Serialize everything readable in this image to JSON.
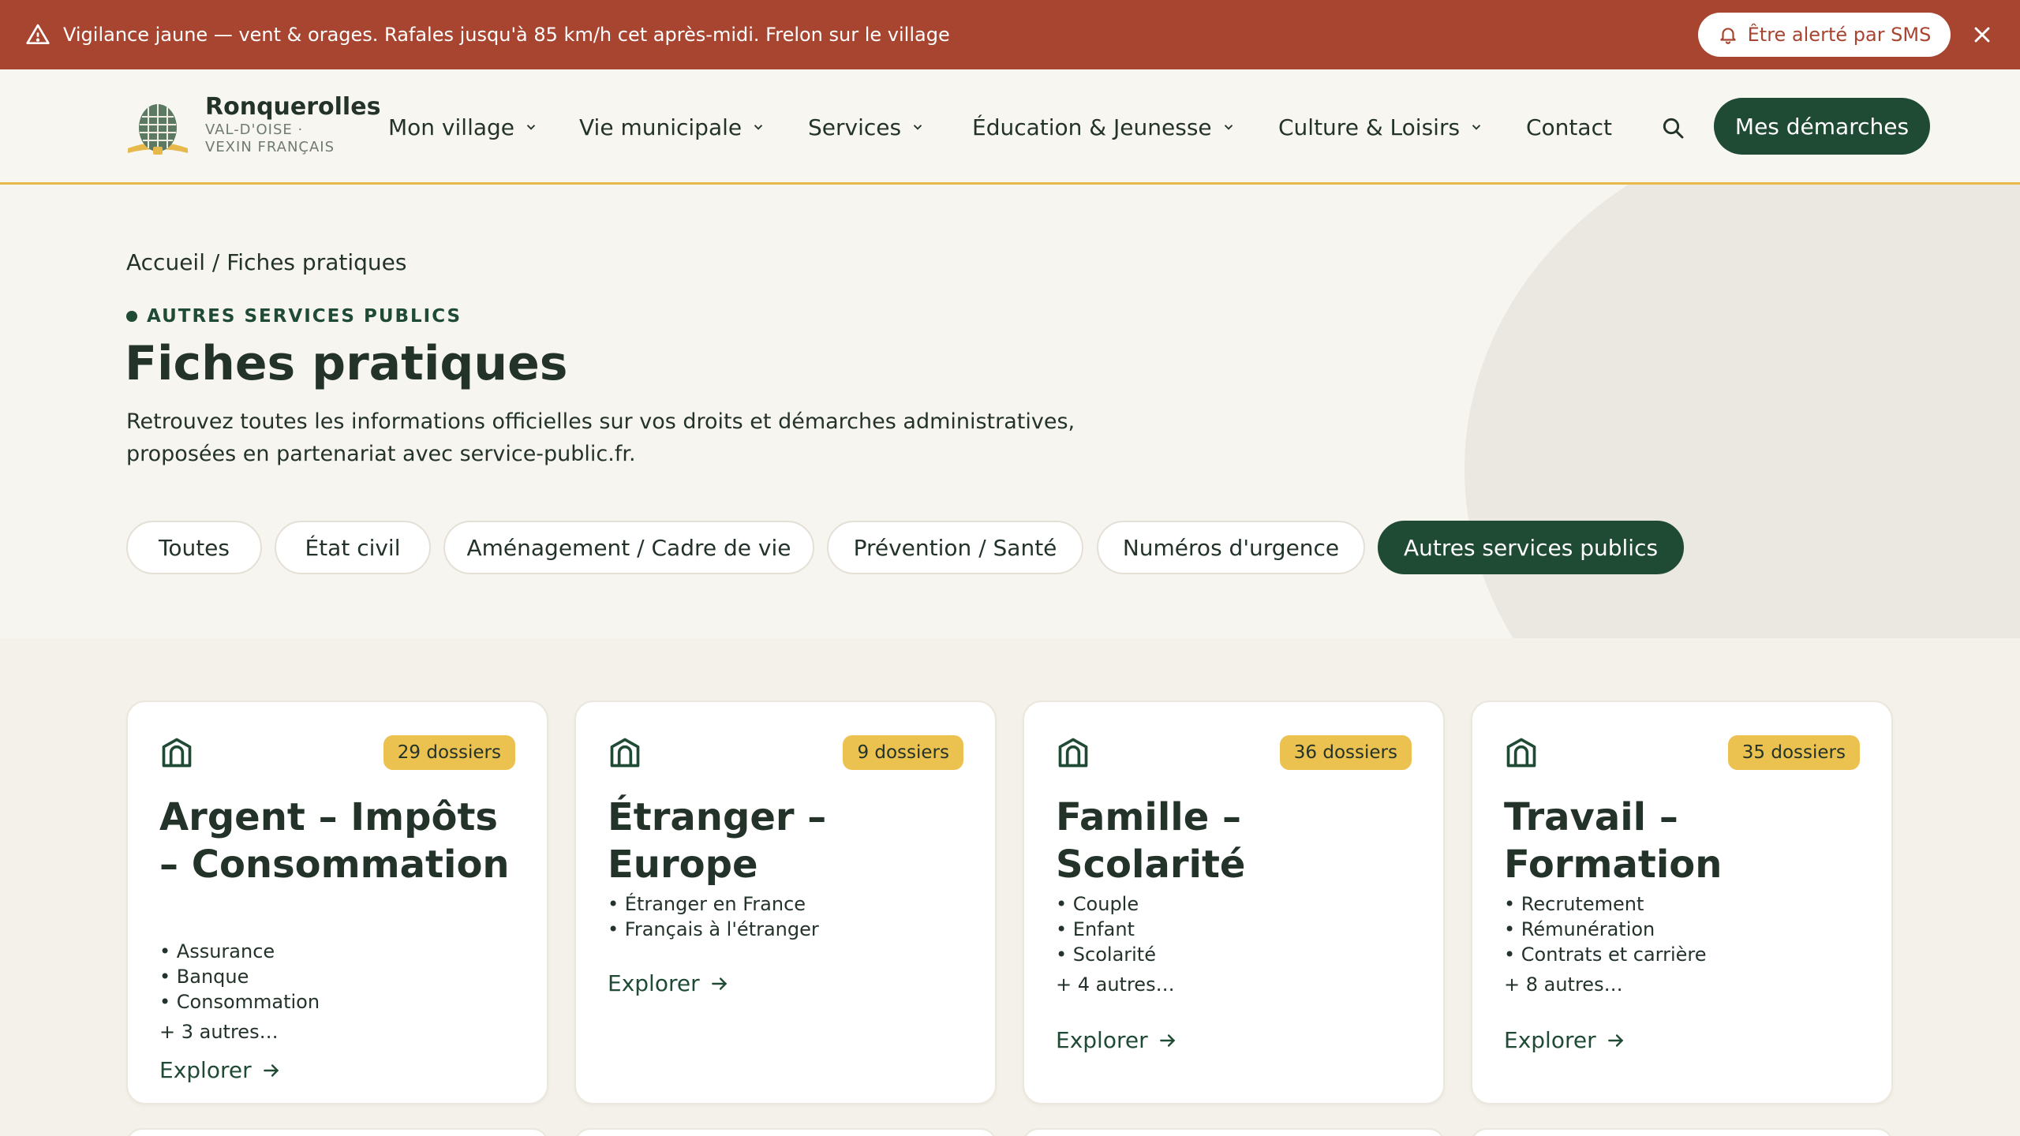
{
  "alert": {
    "message": "Vigilance jaune — vent & orages. Rafales jusqu'à 85 km/h cet après-midi. Frelon sur le village",
    "sms_button": "Être alerté par SMS",
    "icons": {
      "warning": "warning-triangle-icon",
      "bell": "bell-icon",
      "close": "close-icon"
    }
  },
  "header": {
    "brand_name": "Ronquerolles",
    "brand_sub_1": "VAL-D'OISE ·",
    "brand_sub_2": "VEXIN FRANÇAIS",
    "nav": [
      {
        "label": "Mon village",
        "dropdown": true
      },
      {
        "label": "Vie municipale",
        "dropdown": true
      },
      {
        "label": "Services",
        "dropdown": true
      },
      {
        "label": "Éducation & Jeunesse",
        "dropdown": true
      },
      {
        "label": "Culture & Loisirs",
        "dropdown": true
      },
      {
        "label": "Contact",
        "dropdown": false
      }
    ],
    "cta": "Mes démarches"
  },
  "hero": {
    "breadcrumb": "Accueil / Fiches pratiques",
    "eyebrow": "AUTRES SERVICES PUBLICS",
    "title": "Fiches pratiques",
    "lead": "Retrouvez toutes les informations officielles sur vos droits et démarches administratives, proposées en partenariat avec service-public.fr."
  },
  "filters": [
    {
      "label": "Toutes",
      "active": false
    },
    {
      "label": "État civil",
      "active": false
    },
    {
      "label": "Aménagement / Cadre de vie",
      "active": false
    },
    {
      "label": "Prévention / Santé",
      "active": false
    },
    {
      "label": "Numéros d'urgence",
      "active": false
    },
    {
      "label": "Autres services publics",
      "active": true
    }
  ],
  "cards": [
    {
      "badge": "29 dossiers",
      "title": "Argent – Impôts – Consommation",
      "items": [
        "• Assurance",
        "• Banque",
        "• Consommation"
      ],
      "more": "+ 3 autres…",
      "explore": "Explorer"
    },
    {
      "badge": "9 dossiers",
      "title": "Étranger – Europe",
      "items": [
        "• Étranger en France",
        "• Français à l'étranger"
      ],
      "more": "",
      "explore": "Explorer"
    },
    {
      "badge": "36 dossiers",
      "title": "Famille – Scolarité",
      "items": [
        "• Couple",
        "• Enfant",
        "• Scolarité"
      ],
      "more": "+ 4 autres…",
      "explore": "Explorer"
    },
    {
      "badge": "35 dossiers",
      "title": "Travail – Formation",
      "items": [
        "• Recrutement",
        "• Rémunération",
        "• Contrats et carrière"
      ],
      "more": "+ 8 autres…",
      "explore": "Explorer"
    }
  ],
  "colors": {
    "alert_bg": "#a84530",
    "brand_green": "#1f4a34",
    "accent_yellow": "#ebc14f",
    "page_bg": "#f4f1ea"
  }
}
